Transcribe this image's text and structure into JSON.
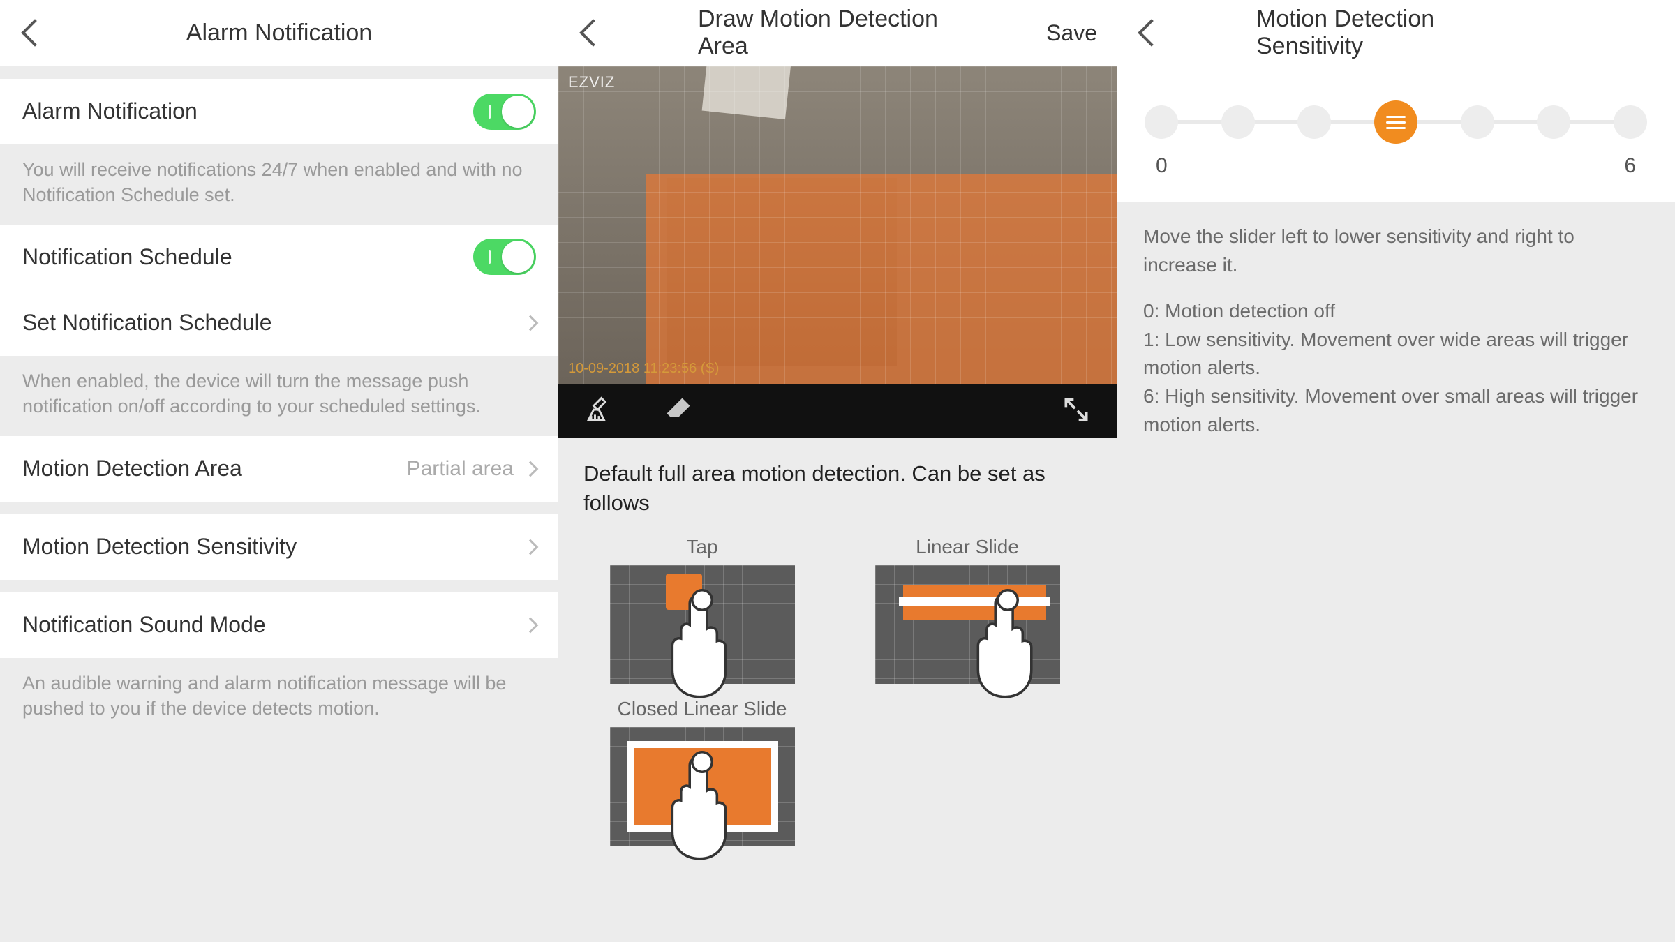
{
  "panel1": {
    "title": "Alarm Notification",
    "rows": {
      "alarm_notification": "Alarm Notification",
      "alarm_helper": "You will receive notifications 24/7 when enabled and with no Notification Schedule set.",
      "notification_schedule": "Notification Schedule",
      "set_notification_schedule": "Set Notification Schedule",
      "schedule_helper": "When enabled, the device will turn the message push notification on/off according to your scheduled settings.",
      "motion_detection_area": "Motion Detection Area",
      "motion_detection_area_value": "Partial area",
      "motion_detection_sensitivity": "Motion Detection Sensitivity",
      "notification_sound_mode": "Notification Sound Mode",
      "sound_helper": "An audible warning and alarm notification message will be pushed to you if the device detects motion."
    }
  },
  "panel2": {
    "title": "Draw Motion Detection Area",
    "save": "Save",
    "brand": "EZVIZ",
    "timestamp": "10-09-2018  11:23:56  (S)",
    "instructions": "Default full area motion detection. Can be set as follows",
    "gestures": {
      "tap": "Tap",
      "linear": "Linear Slide",
      "closed": "Closed Linear Slide"
    }
  },
  "panel3": {
    "title": "Motion Detection Sensitivity",
    "slider": {
      "min": "0",
      "max": "6",
      "value": 3,
      "steps": 7
    },
    "desc_intro": "Move the slider left to lower sensitivity and right to increase it.",
    "desc_0": "0: Motion detection off",
    "desc_1": "1: Low sensitivity. Movement over wide areas will trigger motion alerts.",
    "desc_6": "6: High sensitivity. Movement over small areas will trigger motion alerts."
  }
}
